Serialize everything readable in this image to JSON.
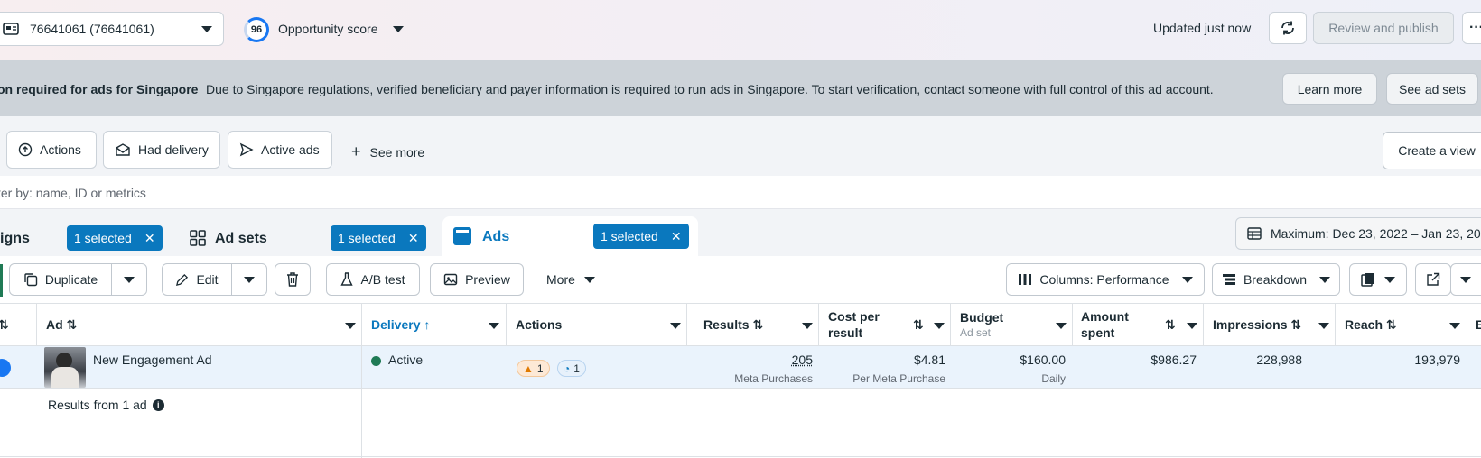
{
  "header": {
    "account_label": "76641061 (76641061)",
    "score_value": "96",
    "score_label": "Opportunity score",
    "updated_text": "Updated just now",
    "review_label": "Review and publish"
  },
  "banner": {
    "title": "on required for ads for Singapore",
    "text": "Due to Singapore regulations, verified beneficiary and payer information is required to run ads in Singapore. To start verification, contact someone with full control of this ad account.",
    "learn_more": "Learn more",
    "see_ad_sets": "See ad sets"
  },
  "chips": {
    "actions": "Actions",
    "had_delivery": "Had delivery",
    "active_ads": "Active ads",
    "see_more": "See more",
    "create_view": "Create a view"
  },
  "filter": {
    "placeholder": "ter by: name, ID or metrics"
  },
  "tabs": {
    "campaigns": {
      "label": "igns",
      "badge": "1 selected"
    },
    "adsets": {
      "label": "Ad sets",
      "badge": "1 selected"
    },
    "ads": {
      "label": "Ads",
      "badge": "1 selected"
    }
  },
  "date_range": "Maximum: Dec 23, 2022 – Jan 23, 20",
  "toolbar": {
    "duplicate": "Duplicate",
    "edit": "Edit",
    "ab_test": "A/B test",
    "preview": "Preview",
    "more": "More",
    "columns": "Columns: Performance",
    "breakdown": "Breakdown"
  },
  "table": {
    "headers": {
      "ad": "Ad",
      "delivery": "Delivery",
      "actions": "Actions",
      "results": "Results",
      "cost_per_result_1": "Cost per",
      "cost_per_result_2": "result",
      "budget": "Budget",
      "budget_sub": "Ad set",
      "amount_spent_1": "Amount",
      "amount_spent_2": "spent",
      "impressions": "Impressions",
      "reach": "Reach",
      "next": "E"
    },
    "row": {
      "ad_name": "New Engagement Ad",
      "delivery": "Active",
      "warn_count": "1",
      "info_count": "1",
      "results": "205",
      "results_sub": "Meta Purchases",
      "cost": "$4.81",
      "cost_sub": "Per Meta Purchase",
      "budget": "$160.00",
      "budget_sub": "Daily",
      "amount_spent": "$986.27",
      "impressions": "228,988",
      "reach": "193,979"
    },
    "summary": "Results from 1 ad"
  },
  "colors": {
    "brand_blue": "#0a78be",
    "active_green": "#1f7a55",
    "warning": "#e07a00"
  }
}
